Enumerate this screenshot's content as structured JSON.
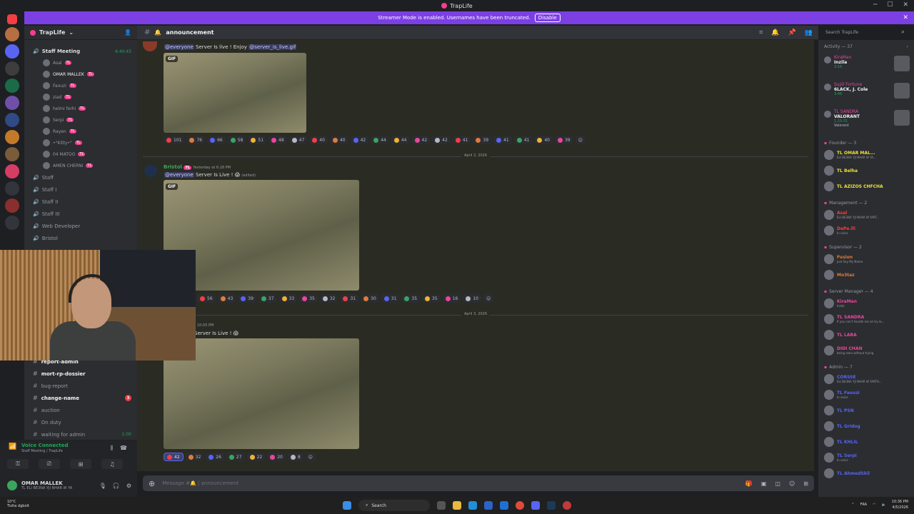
{
  "window": {
    "title": "TrapLife"
  },
  "banner": {
    "text": "Streamer Mode is enabled. Usernames have been truncated.",
    "button": "Disable"
  },
  "server": {
    "name": "TrapLife"
  },
  "sidebar": {
    "voice_channel": {
      "name": "Staff Meeting",
      "timer": "4:40:43"
    },
    "voice_members": [
      "Asal",
      "OMAR MALLEK",
      "Faouzi",
      "ziad",
      "helmi ferhi",
      "Serpi",
      "Rayen",
      "•°Kitty•°",
      "04 MATOO",
      "AMEN CHERNI"
    ],
    "member_tag": "TL",
    "staff_channels": [
      "Staff",
      "Staff I",
      "Staff II",
      "Staff III",
      "Web Developer",
      "Bristol"
    ],
    "text_channels": [
      {
        "name": "report-admin",
        "bold": true
      },
      {
        "name": "mort-rp-dossier",
        "bold": true
      },
      {
        "name": "bug-report",
        "bold": false
      },
      {
        "name": "change-name",
        "bold": true,
        "badge": "3"
      },
      {
        "name": "auction",
        "bold": false
      },
      {
        "name": "On duty",
        "bold": false
      },
      {
        "name": "waiting for admin",
        "bold": false,
        "timer": "1:00"
      }
    ]
  },
  "voice_panel": {
    "status": "Voice Connected",
    "sub": "Staff Meeting / TrapLife"
  },
  "user_panel": {
    "name": "OMAR MALLEK",
    "status": "TL ELI BE3NA YJI NHAR W YA"
  },
  "channel": {
    "name": "announcement",
    "search_placeholder": "Search TrapLife"
  },
  "messages": {
    "m1": {
      "text_mention": "@everyone",
      "text": "Server Is live ! Enjoy",
      "text_link": "@server_is_live.gif",
      "gif": "GIF",
      "reactions": [
        "101",
        "76",
        "66",
        "58",
        "51",
        "48",
        "47",
        "40",
        "40",
        "42",
        "44",
        "44",
        "42",
        "42",
        "41",
        "39",
        "41",
        "41",
        "40",
        "39"
      ]
    },
    "date1": "April 2, 2026",
    "m2": {
      "author": "Bristol",
      "tag": "TL",
      "meta": "Yesterday at 6:18 PM",
      "mention": "@everyone",
      "text": "Server Is Live ! 😱",
      "edited": "(edited)",
      "gif": "GIF",
      "reactions": [
        "56",
        "43",
        "39",
        "37",
        "33",
        "35",
        "32",
        "31",
        "30",
        "31",
        "35",
        "35",
        "16",
        "10"
      ]
    },
    "date2": "April 3, 2026",
    "m3": {
      "meta": "10:05 PM",
      "text": "Server Is Live ! 😱",
      "reactions": [
        "42",
        "32",
        "26",
        "27",
        "22",
        "20",
        "8"
      ]
    }
  },
  "composer": {
    "placeholder": "Message #🔔 | announcement"
  },
  "members": {
    "activity_header": "Activity — 37",
    "activities": [
      {
        "name": "KiraMan",
        "detail": "Inzila",
        "time": "3:16"
      },
      {
        "name": "Sujiil Fortune",
        "detail": "6LACK, J. Cole",
        "time": "3:46"
      },
      {
        "name": "TL SANDRA",
        "detail": "VALORANT",
        "time": "1:15:31",
        "extra": "Valorant"
      }
    ],
    "roles": [
      {
        "title": "Founder — 3",
        "members": [
          {
            "name": "TL OMAR MAL...",
            "sub": "ELI BE3NA YJI NHAR W YA...",
            "color": "#f0e138"
          },
          {
            "name": "TL Belha",
            "sub": "",
            "color": "#f0e138"
          },
          {
            "name": "TL AZIZOS CHFCHA",
            "sub": "",
            "color": "#f0e138"
          }
        ]
      },
      {
        "title": "Management — 2",
        "members": [
          {
            "name": "Asal",
            "sub": "ELI BE3NA YJI NHAR W YART...",
            "color": "#f23f43"
          },
          {
            "name": "DaPe.lli",
            "sub": "In voice",
            "color": "#f23f43"
          }
        ]
      },
      {
        "title": "Supervisor — 2",
        "members": [
          {
            "name": "Fusion",
            "sub": "Just Say My Name",
            "color": "#e07b39"
          },
          {
            "name": "Mo3taz",
            "sub": "",
            "color": "#e07b39"
          }
        ]
      },
      {
        "title": "Server Manager — 4",
        "members": [
          {
            "name": "KiraMan",
            "sub": "Inzila",
            "color": "#eb459e"
          },
          {
            "name": "TL SANDRA",
            "sub": "If you can't handle me at my la...",
            "color": "#eb459e"
          },
          {
            "name": "TL LARA",
            "sub": "",
            "color": "#eb459e"
          },
          {
            "name": "DIDI CHAN",
            "sub": "being seen without trying",
            "color": "#eb459e"
          }
        ]
      },
      {
        "title": "Admin — 7",
        "members": [
          {
            "name": "CORSSE",
            "sub": "ELI BE3NA YJI NHAR W YARTH...",
            "color": "#5865f2"
          },
          {
            "name": "TL Faouzi",
            "sub": "In voice",
            "color": "#5865f2"
          },
          {
            "name": "TL PSN",
            "sub": "",
            "color": "#5865f2"
          },
          {
            "name": "TL Gridog",
            "sub": "",
            "color": "#5865f2"
          },
          {
            "name": "TL KHLIL",
            "sub": "",
            "color": "#5865f2"
          },
          {
            "name": "TL Serpi",
            "sub": "In voice",
            "color": "#5865f2"
          },
          {
            "name": "TL AhmedSkil",
            "sub": "",
            "color": "#5865f2"
          }
        ]
      }
    ]
  },
  "taskbar": {
    "weather_temp": "10°C",
    "weather_desc": "Tizita dgbolt",
    "search": "Search",
    "lang": "FRA",
    "time": "10:36 PM",
    "date": "4/5/2026"
  }
}
